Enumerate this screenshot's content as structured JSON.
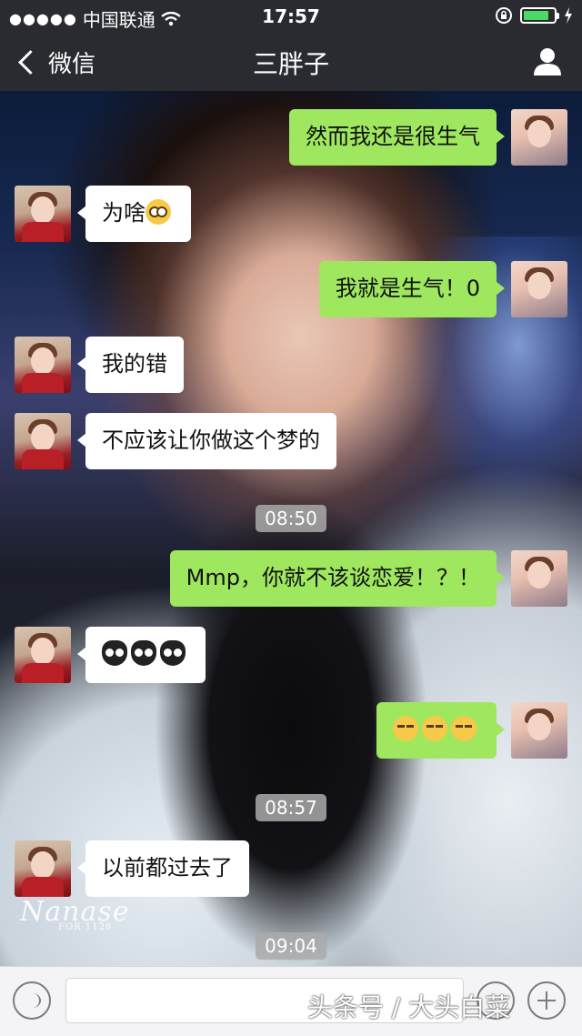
{
  "status_bar": {
    "carrier": "中国联通",
    "time": "17:57",
    "battery_level_percent": 85,
    "icons": [
      "signal-dots-icon",
      "wifi-icon",
      "rotation-lock-icon",
      "battery-icon",
      "charging-icon"
    ]
  },
  "nav": {
    "back_label": "微信",
    "title": "三胖子",
    "right_icon": "profile-icon"
  },
  "messages": [
    {
      "side": "right",
      "text": "然而我还是很生气"
    },
    {
      "side": "left",
      "text": "为啥",
      "emoji": "flushed-face"
    },
    {
      "side": "right",
      "text": "我就是生气！0"
    },
    {
      "side": "left",
      "text": "我的错"
    },
    {
      "side": "left",
      "text": "不应该让你做这个梦的"
    },
    {
      "type": "time",
      "text": "08:50"
    },
    {
      "side": "right",
      "text": "Mmp，你就不该谈恋爱！？！"
    },
    {
      "side": "left",
      "emoji": "sheep-face x3"
    },
    {
      "side": "right",
      "emoji": "unamused-face x3"
    },
    {
      "type": "time",
      "text": "08:57"
    },
    {
      "side": "left",
      "text": "以前都过去了"
    },
    {
      "type": "time",
      "text": "09:04"
    }
  ],
  "background_signature": {
    "name": "Nanase",
    "sub": "FOR 1128"
  },
  "input_bar": {
    "placeholder": "",
    "icons": [
      "voice-icon",
      "emoji-icon",
      "plus-icon"
    ]
  },
  "watermark": "头条号 / 大头白菜",
  "colors": {
    "bar_bg": "#2a2b30",
    "my_bubble": "#9fe75f",
    "their_bubble": "#ffffff",
    "time_pill": "#aaaaaa"
  }
}
